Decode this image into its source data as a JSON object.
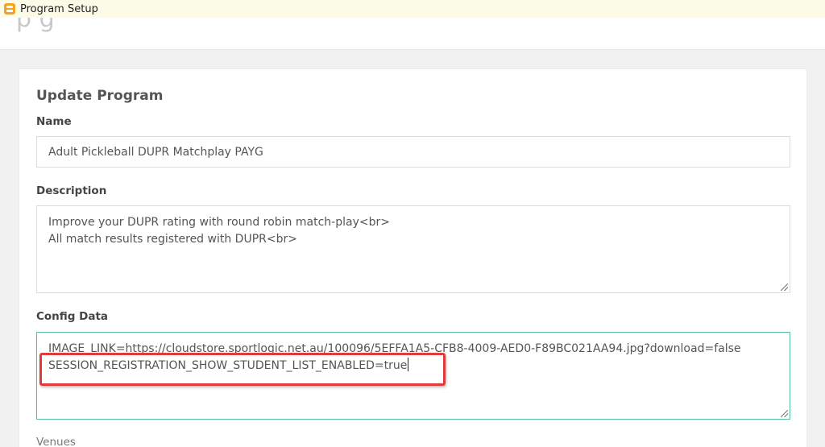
{
  "window": {
    "title": "Program Setup"
  },
  "form": {
    "heading": "Update Program",
    "name": {
      "label": "Name",
      "value": "Adult Pickleball DUPR Matchplay PAYG"
    },
    "description": {
      "label": "Description",
      "lines": [
        "Improve your DUPR rating with round robin match-play<br>",
        "All match results registered with DUPR<br>"
      ]
    },
    "config": {
      "label": "Config Data",
      "lines": [
        "IMAGE_LINK=https://cloudstore.sportlogic.net.au/100096/5EFFA1A5-CFB8-4009-AED0-F89BC021AA94.jpg?download=false",
        "SESSION_REGISTRATION_SHOW_STUDENT_LIST_ENABLED=true"
      ]
    },
    "venues": {
      "label": "Venues"
    }
  },
  "colors": {
    "highlight": "#e03a3a",
    "focus_border": "#5bbfa6",
    "titlebar_bg": "#fbfbe8"
  },
  "icons": {
    "app": "app-icon",
    "resize": "resize-grip-icon"
  }
}
